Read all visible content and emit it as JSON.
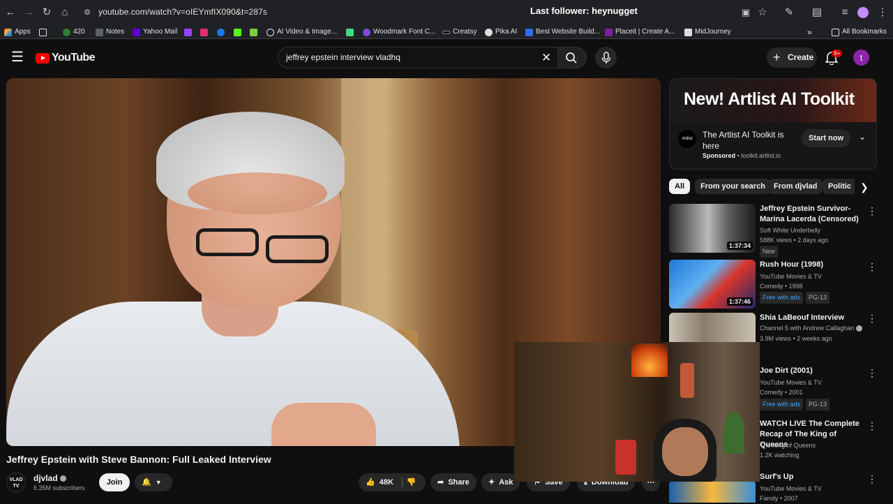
{
  "browser": {
    "url": "youtube.com/watch?v=oIEYmfIX090&t=287s",
    "overlay_text": "Last follower: heynugget",
    "bookmarks": [
      {
        "label": "Apps"
      },
      {
        "label": "420"
      },
      {
        "label": "Notes"
      },
      {
        "label": "Yahoo Mail"
      },
      {
        "label": "AI Video & Image..."
      },
      {
        "label": "Woodmark Font C..."
      },
      {
        "label": "Creatsy"
      },
      {
        "label": "Pika AI"
      },
      {
        "label": "Best Website Build..."
      },
      {
        "label": "Placeit | Create A..."
      },
      {
        "label": "MidJourney"
      }
    ],
    "all_bookmarks": "All Bookmarks"
  },
  "youtube": {
    "logo": "YouTube",
    "search_query": "jeffrey epstein interview vladhq",
    "create_label": "Create",
    "notif_count": "9+",
    "avatar_letter": "t"
  },
  "ad": {
    "banner": "New! Artlist AI Toolkit",
    "logo_text": "Artlist",
    "title": "The Artlist AI Toolkit is here",
    "sponsored": "Sponsored",
    "domain": "toolkit.artlist.io",
    "cta": "Start now"
  },
  "chips": [
    "All",
    "From your search",
    "From djvlad",
    "Politic"
  ],
  "recommendations": [
    {
      "title": "Jeffrey Epstein Survivor-Marina Lacerda (Censored)",
      "channel": "Soft White Underbelly",
      "meta": "588K views • 2 days ago",
      "badge": "New",
      "duration": "1:37:34"
    },
    {
      "title": "Rush Hour (1998)",
      "channel": "YouTube Movies & TV",
      "meta": "Comedy • 1998",
      "badge": "Free with ads",
      "rating": "PG-13",
      "duration": "1:37:46"
    },
    {
      "title": "Shia LaBeouf Interview",
      "channel": "Channel 5 with Andrew Callaghan",
      "meta": "3.9M views • 2 weeks ago"
    },
    {
      "title": "Joe Dirt (2001)",
      "channel": "YouTube Movies & TV",
      "meta": "Comedy • 2001",
      "badge": "Free with ads",
      "rating": "PG-13"
    },
    {
      "title": "WATCH LIVE The Complete Recap of The King of Queens",
      "channel": "The King of Queens",
      "meta": "1.2K watching"
    },
    {
      "title": "Surf's Up",
      "channel": "YouTube Movies & TV",
      "meta": "Family • 2007"
    }
  ],
  "video": {
    "title": "Jeffrey Epstein with Steve Bannon: Full Leaked Interview",
    "channel": "djvlad",
    "channel_avatar_text": "VLAD TV",
    "subscribers": "6.35M subscribers",
    "join": "Join",
    "likes": "48K",
    "share": "Share",
    "ask": "Ask",
    "save": "Save",
    "download": "Download"
  },
  "colors": {
    "background": "#0f0f0f",
    "youtube_red": "#ff0000",
    "chip_active": "#f1f1f1",
    "free_with_ads": "#3ea6ff"
  }
}
